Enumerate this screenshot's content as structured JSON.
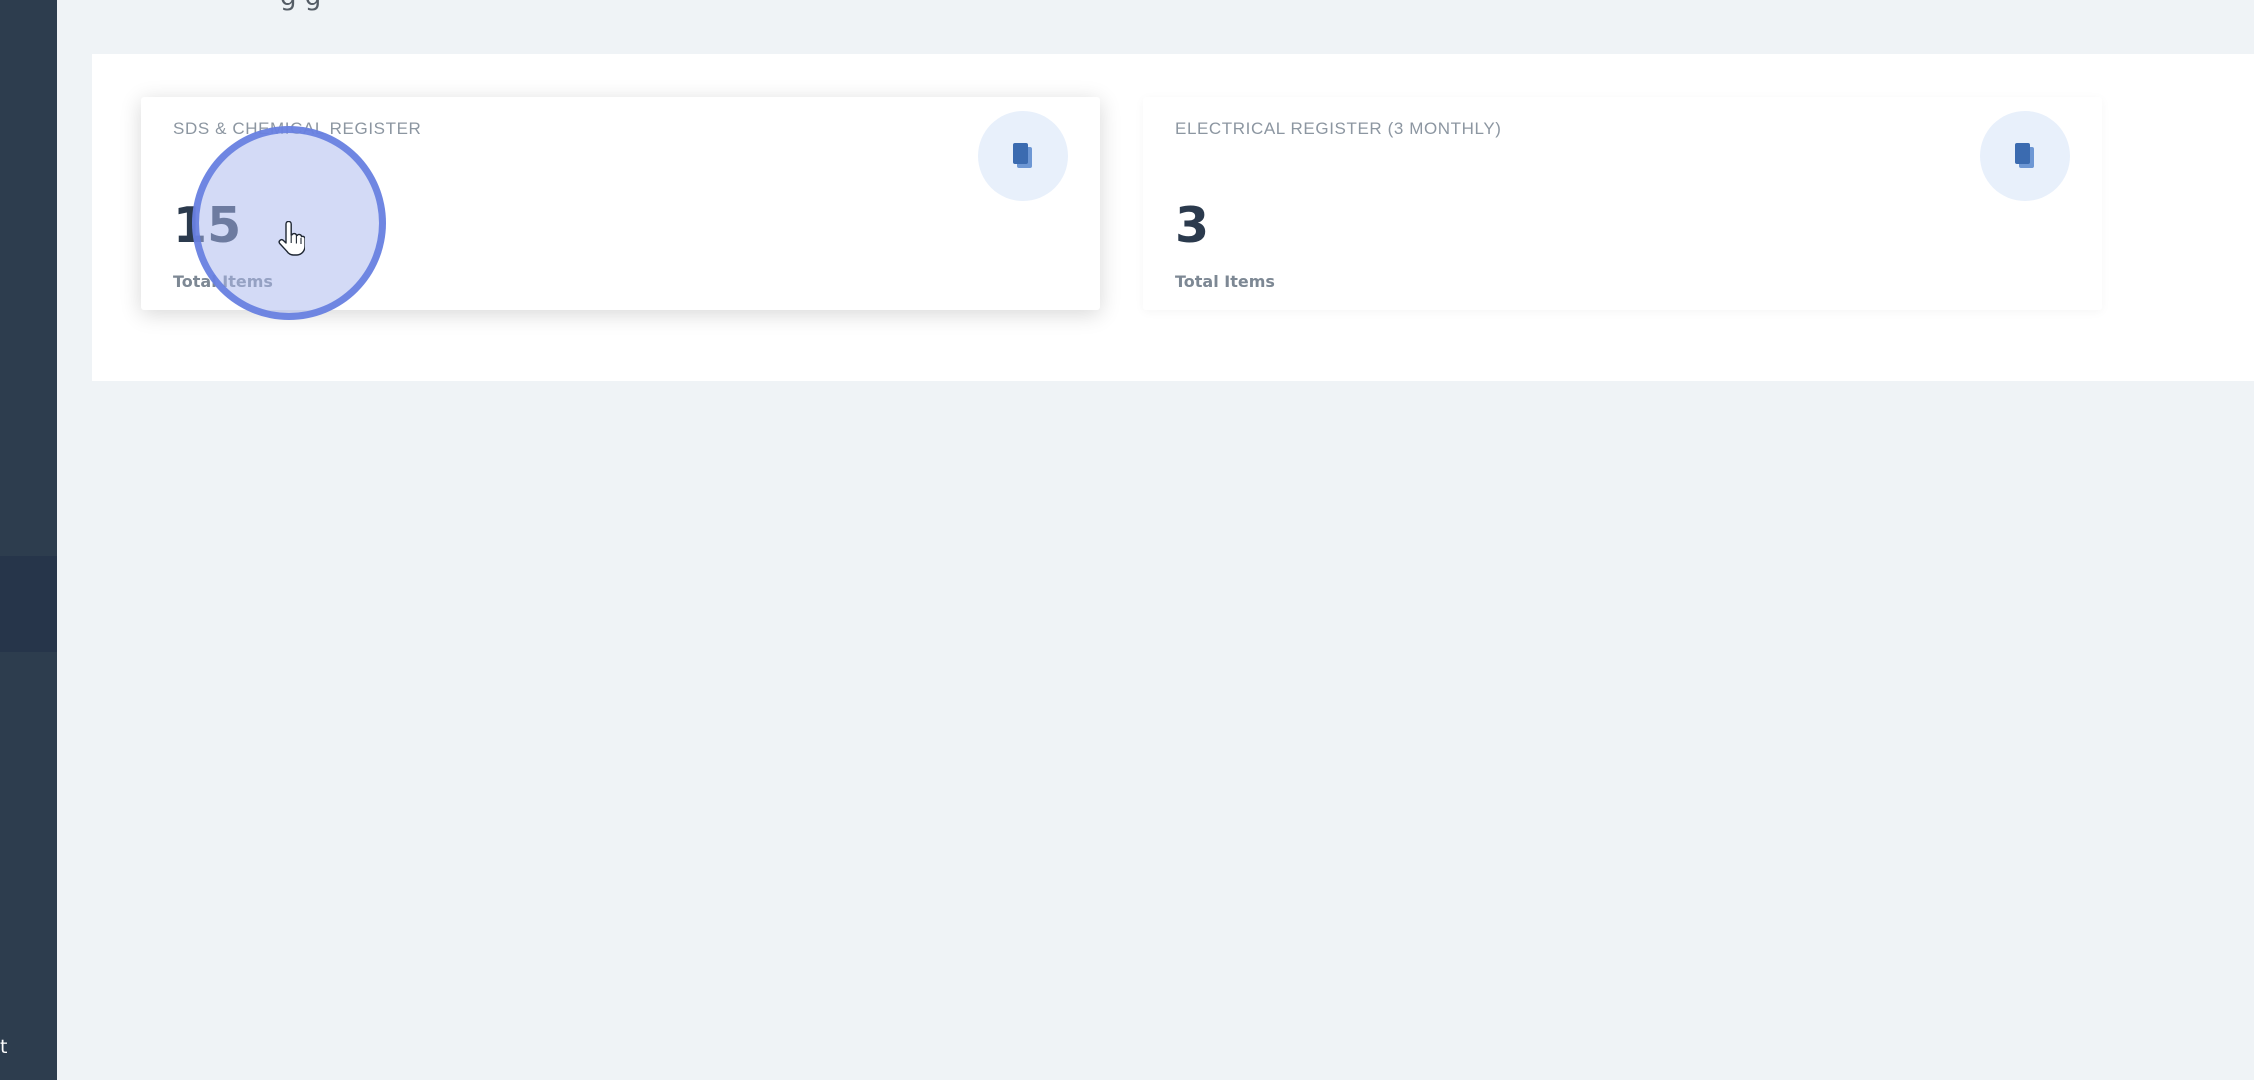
{
  "sidebar": {
    "bottom_text": "t"
  },
  "page": {
    "top_text": "g                              g"
  },
  "cards": [
    {
      "title": "SDS & CHEMICAL REGISTER",
      "value": "15",
      "subtitle": "Total Items",
      "icon": "copy-icon"
    },
    {
      "title": "ELECTRICAL REGISTER (3 MONTHLY)",
      "value": "3",
      "subtitle": "Total Items",
      "icon": "copy-icon"
    }
  ],
  "colors": {
    "sidebar": "#2d3d4e",
    "background": "#eff3f6",
    "icon_accent": "#3b6bb0",
    "icon_bg": "#e8f0fb",
    "click_ring": "#647de0"
  }
}
